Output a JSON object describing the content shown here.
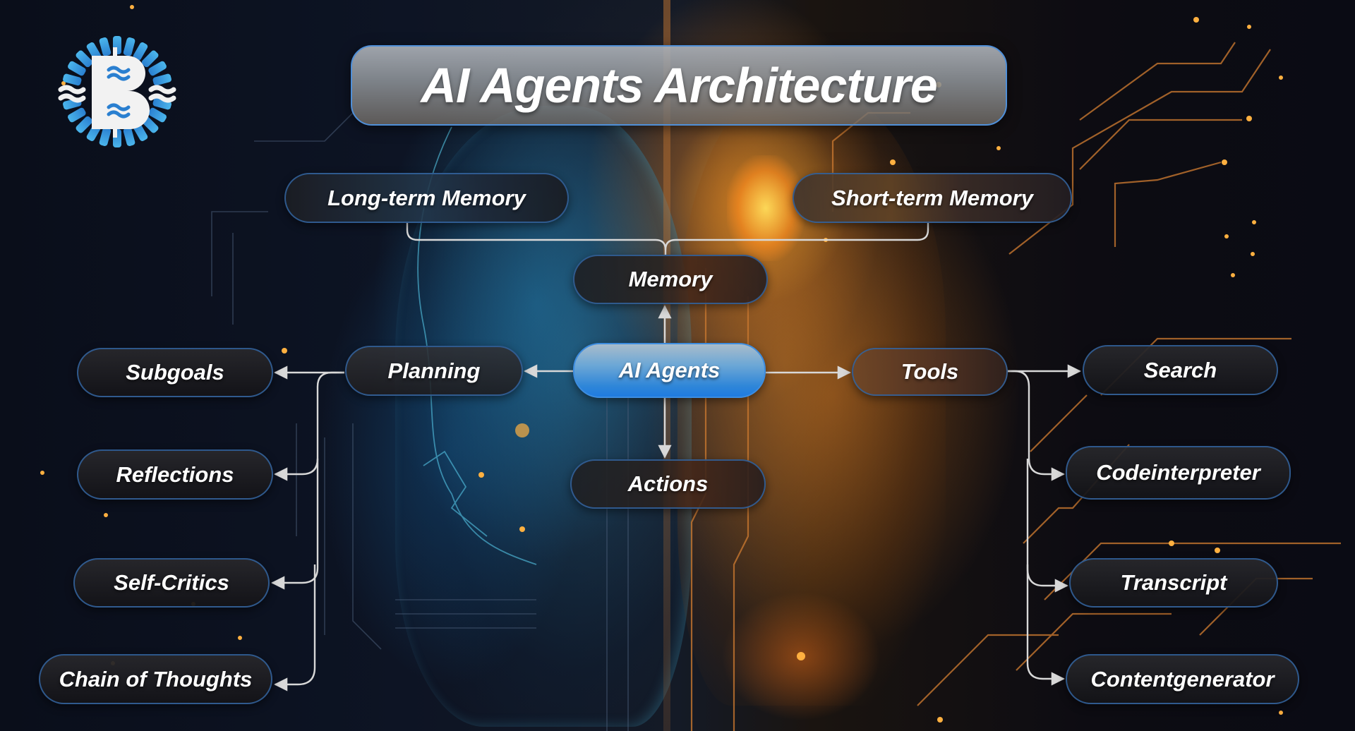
{
  "title": "AI Agents Architecture",
  "logo": {
    "letter": "B",
    "icon": "b-waves-logo-icon"
  },
  "colors": {
    "accent_blue": "#2f86d8",
    "node_border": "#32649f",
    "connector": "#d8d8d8",
    "title_border": "#4f8fd8",
    "text": "#ffffff"
  },
  "nodes": {
    "ai_agents": "AI Agents",
    "memory": "Memory",
    "long_term_memory": "Long-term Memory",
    "short_term_memory": "Short-term Memory",
    "planning": "Planning",
    "subgoals": "Subgoals",
    "reflections": "Reflections",
    "self_critics": "Self-Critics",
    "chain_of_thoughts": "Chain of Thoughts",
    "tools": "Tools",
    "search": "Search",
    "codeinterpreter": "Codeinterpreter",
    "transcript": "Transcript",
    "contentgenerator": "Contentgenerator",
    "actions": "Actions"
  },
  "edges": [
    {
      "from": "AI Agents",
      "to": "Memory"
    },
    {
      "from": "Memory",
      "to": "Long-term Memory"
    },
    {
      "from": "Memory",
      "to": "Short-term Memory"
    },
    {
      "from": "AI Agents",
      "to": "Planning"
    },
    {
      "from": "Planning",
      "to": "Subgoals"
    },
    {
      "from": "Planning",
      "to": "Reflections"
    },
    {
      "from": "Planning",
      "to": "Self-Critics"
    },
    {
      "from": "Planning",
      "to": "Chain of Thoughts"
    },
    {
      "from": "AI Agents",
      "to": "Tools"
    },
    {
      "from": "Tools",
      "to": "Search"
    },
    {
      "from": "Tools",
      "to": "Codeinterpreter"
    },
    {
      "from": "Tools",
      "to": "Transcript"
    },
    {
      "from": "Tools",
      "to": "Contentgenerator"
    },
    {
      "from": "AI Agents",
      "to": "Actions"
    }
  ]
}
